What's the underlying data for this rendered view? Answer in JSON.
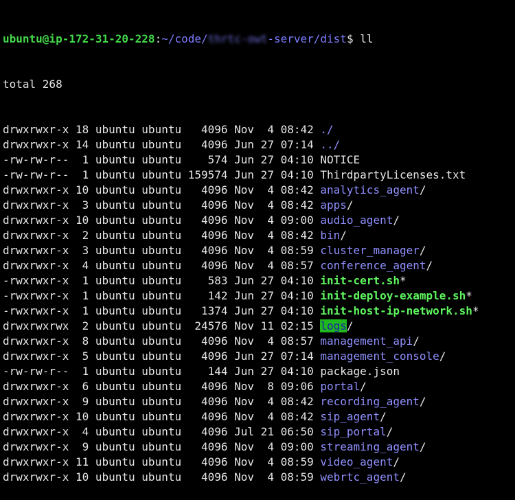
{
  "prompt": {
    "user_host": "ubuntu@ip-172-31-20-228",
    "sep": ":",
    "path_pre": "~/code/",
    "path_blurred": "thrtc-owt",
    "path_post": "-server/dist",
    "symbol": "$ ",
    "command": "ll"
  },
  "total": "total 268",
  "colors": {
    "background": "#000000",
    "text": "#e6e6e6",
    "prompt_user": "#43d84a",
    "directory": "#8f8fff",
    "executable": "#5ff55f",
    "highlight_bg": "#1fb81f"
  },
  "entries": [
    {
      "meta": "drwxrwxr-x 18 ubuntu ubuntu   4096 Nov  4 08:42 ",
      "name": "./",
      "type": "dir-dot",
      "suffix": ""
    },
    {
      "meta": "drwxrwxr-x 14 ubuntu ubuntu   4096 Jun 27 07:14 ",
      "name": "../",
      "type": "dir-dot",
      "suffix": ""
    },
    {
      "meta": "-rw-rw-r--  1 ubuntu ubuntu    574 Jun 27 04:10 ",
      "name": "NOTICE",
      "type": "file",
      "suffix": ""
    },
    {
      "meta": "-rw-rw-r--  1 ubuntu ubuntu 159574 Jun 27 04:10 ",
      "name": "ThirdpartyLicenses.txt",
      "type": "file",
      "suffix": ""
    },
    {
      "meta": "drwxrwxr-x 10 ubuntu ubuntu   4096 Nov  4 08:42 ",
      "name": "analytics_agent",
      "type": "dir",
      "suffix": "/"
    },
    {
      "meta": "drwxrwxr-x  3 ubuntu ubuntu   4096 Nov  4 08:42 ",
      "name": "apps",
      "type": "dir",
      "suffix": "/"
    },
    {
      "meta": "drwxrwxr-x 10 ubuntu ubuntu   4096 Nov  4 09:00 ",
      "name": "audio_agent",
      "type": "dir",
      "suffix": "/"
    },
    {
      "meta": "drwxrwxr-x  2 ubuntu ubuntu   4096 Nov  4 08:42 ",
      "name": "bin",
      "type": "dir",
      "suffix": "/"
    },
    {
      "meta": "drwxrwxr-x  3 ubuntu ubuntu   4096 Nov  4 08:59 ",
      "name": "cluster_manager",
      "type": "dir",
      "suffix": "/"
    },
    {
      "meta": "drwxrwxr-x  4 ubuntu ubuntu   4096 Nov  4 08:57 ",
      "name": "conference_agent",
      "type": "dir",
      "suffix": "/"
    },
    {
      "meta": "-rwxrwxr-x  1 ubuntu ubuntu    583 Jun 27 04:10 ",
      "name": "init-cert.sh",
      "type": "exec",
      "suffix": "*"
    },
    {
      "meta": "-rwxrwxr-x  1 ubuntu ubuntu    142 Jun 27 04:10 ",
      "name": "init-deploy-example.sh",
      "type": "exec",
      "suffix": "*"
    },
    {
      "meta": "-rwxrwxr-x  1 ubuntu ubuntu   1374 Jun 27 04:10 ",
      "name": "init-host-ip-network.sh",
      "type": "exec",
      "suffix": "*"
    },
    {
      "meta": "drwxrwxrwx  2 ubuntu ubuntu  24576 Nov 11 02:15 ",
      "name": "logs",
      "type": "dir-hl",
      "suffix": "/"
    },
    {
      "meta": "drwxrwxr-x  8 ubuntu ubuntu   4096 Nov  4 08:57 ",
      "name": "management_api",
      "type": "dir",
      "suffix": "/"
    },
    {
      "meta": "drwxrwxr-x  5 ubuntu ubuntu   4096 Jun 27 07:14 ",
      "name": "management_console",
      "type": "dir",
      "suffix": "/"
    },
    {
      "meta": "-rw-rw-r--  1 ubuntu ubuntu    144 Jun 27 04:10 ",
      "name": "package.json",
      "type": "file",
      "suffix": ""
    },
    {
      "meta": "drwxrwxr-x  6 ubuntu ubuntu   4096 Nov  8 09:06 ",
      "name": "portal",
      "type": "dir",
      "suffix": "/"
    },
    {
      "meta": "drwxrwxr-x  9 ubuntu ubuntu   4096 Nov  4 08:42 ",
      "name": "recording_agent",
      "type": "dir",
      "suffix": "/"
    },
    {
      "meta": "drwxrwxr-x 10 ubuntu ubuntu   4096 Nov  4 08:42 ",
      "name": "sip_agent",
      "type": "dir",
      "suffix": "/"
    },
    {
      "meta": "drwxrwxr-x  4 ubuntu ubuntu   4096 Jul 21 06:50 ",
      "name": "sip_portal",
      "type": "dir",
      "suffix": "/"
    },
    {
      "meta": "drwxrwxr-x  9 ubuntu ubuntu   4096 Nov  4 09:00 ",
      "name": "streaming_agent",
      "type": "dir",
      "suffix": "/"
    },
    {
      "meta": "drwxrwxr-x 11 ubuntu ubuntu   4096 Nov  4 08:59 ",
      "name": "video_agent",
      "type": "dir",
      "suffix": "/"
    },
    {
      "meta": "drwxrwxr-x 10 ubuntu ubuntu   4096 Nov  4 08:59 ",
      "name": "webrtc_agent",
      "type": "dir",
      "suffix": "/"
    }
  ]
}
